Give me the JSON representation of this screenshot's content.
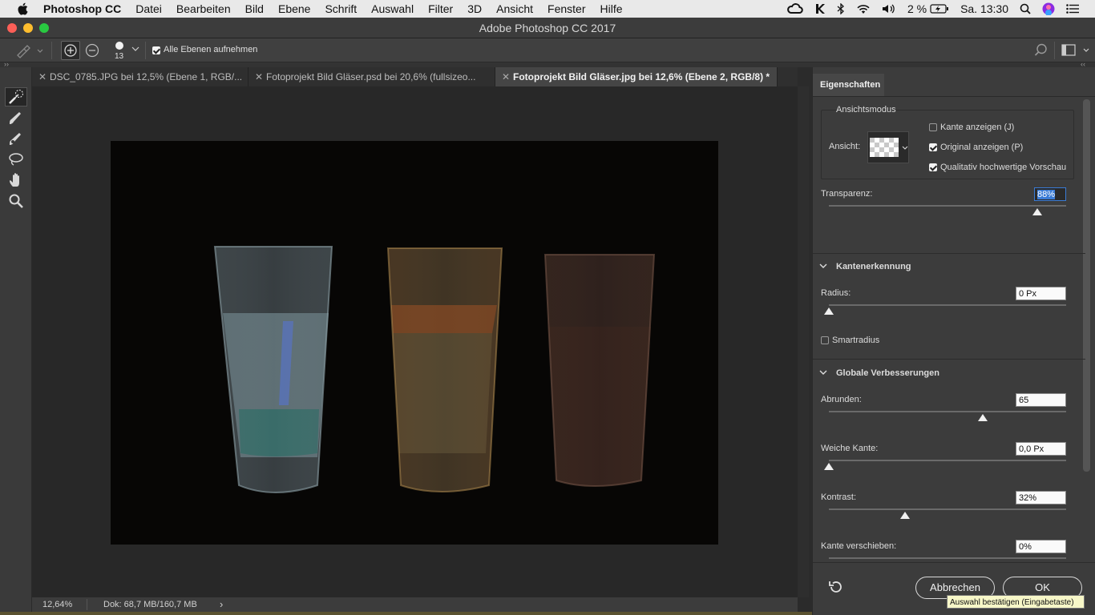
{
  "menubar": {
    "app_name": "Photoshop CC",
    "items": [
      "Datei",
      "Bearbeiten",
      "Bild",
      "Ebene",
      "Schrift",
      "Auswahl",
      "Filter",
      "3D",
      "Ansicht",
      "Fenster",
      "Hilfe"
    ],
    "battery": "2 %",
    "clock": "Sa. 13:30"
  },
  "window": {
    "title": "Adobe Photoshop CC 2017"
  },
  "options_bar": {
    "brush_size": "13",
    "sample_all_layers_label": "Alle Ebenen aufnehmen",
    "sample_all_layers_checked": true
  },
  "tabs": [
    {
      "label": "DSC_0785.JPG bei 12,5% (Ebene 1, RGB/...",
      "active": false
    },
    {
      "label": "Fotoprojekt Bild Gläser.psd bei 20,6% (fullsizeo...",
      "active": false
    },
    {
      "label": "Fotoprojekt Bild Gläser.jpg bei 12,6% (Ebene 2, RGB/8) *",
      "active": true
    }
  ],
  "status_bar": {
    "zoom": "12,64%",
    "doc_size": "Dok: 68,7 MB/160,7 MB",
    "arrow": "›"
  },
  "panel": {
    "tab_label": "Eigenschaften",
    "view_mode": {
      "section_label": "Ansichtsmodus",
      "view_label": "Ansicht:",
      "show_edge_label": "Kante anzeigen (J)",
      "show_edge_checked": false,
      "show_original_label": "Original anzeigen (P)",
      "show_original_checked": true,
      "hq_preview_label": "Qualitativ hochwertige Vorschau",
      "hq_preview_checked": true
    },
    "transparency": {
      "label": "Transparenz:",
      "value": "88%",
      "level": 0.88
    },
    "edge_detection": {
      "section_label": "Kantenerkennung",
      "radius_label": "Radius:",
      "radius_value": "0 Px",
      "radius_level": 0.0,
      "smart_radius_label": "Smartradius",
      "smart_radius_checked": false
    },
    "global_refinements": {
      "section_label": "Globale Verbesserungen",
      "smooth_label": "Abrunden:",
      "smooth_value": "65",
      "smooth_level": 0.65,
      "feather_label": "Weiche Kante:",
      "feather_value": "0,0 Px",
      "feather_level": 0.0,
      "contrast_label": "Kontrast:",
      "contrast_value": "32%",
      "contrast_level": 0.32,
      "shift_edge_label": "Kante verschieben:",
      "shift_edge_value": "0%"
    },
    "cancel_label": "Abbrechen",
    "ok_label": "OK",
    "tooltip": "Auswahl bestätigen (Eingabetaste)"
  }
}
